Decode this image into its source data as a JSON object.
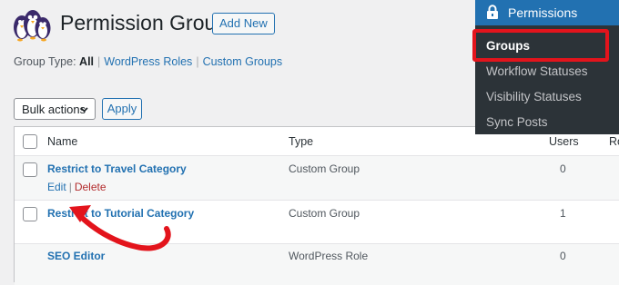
{
  "header": {
    "title": "Permission Groups",
    "add_new_label": "Add New"
  },
  "filters": {
    "label": "Group Type:",
    "all": "All",
    "wordpress_roles": "WordPress Roles",
    "custom_groups": "Custom Groups"
  },
  "bulk": {
    "select_value": "Bulk actions",
    "apply_label": "Apply"
  },
  "table": {
    "columns": {
      "name": "Name",
      "type": "Type",
      "users": "Users",
      "roles": "Ro"
    },
    "rows": [
      {
        "name": "Restrict to Travel Category",
        "type": "Custom Group",
        "users": "0",
        "actions": {
          "edit": "Edit",
          "separator": "|",
          "delete": "Delete"
        }
      },
      {
        "name": "Restrict to Tutorial Category",
        "type": "Custom Group",
        "users": "1"
      },
      {
        "name": "SEO Editor",
        "type": "WordPress Role",
        "users": "0"
      }
    ]
  },
  "admin_menu": {
    "parent_label": "Permissions",
    "items": [
      {
        "label": "Groups",
        "active": true
      },
      {
        "label": "Workflow Statuses"
      },
      {
        "label": "Visibility Statuses"
      },
      {
        "label": "Sync Posts"
      }
    ]
  },
  "icons": {
    "logo": "penguins-logo-icon",
    "lock": "lock-icon",
    "chevron": "chevron-down-icon",
    "annotation": "red-arrow-icon"
  },
  "colors": {
    "accent": "#2271b1",
    "menu_bg": "#2c3338",
    "highlight": "#e3141c",
    "delete": "#b32d2e"
  }
}
